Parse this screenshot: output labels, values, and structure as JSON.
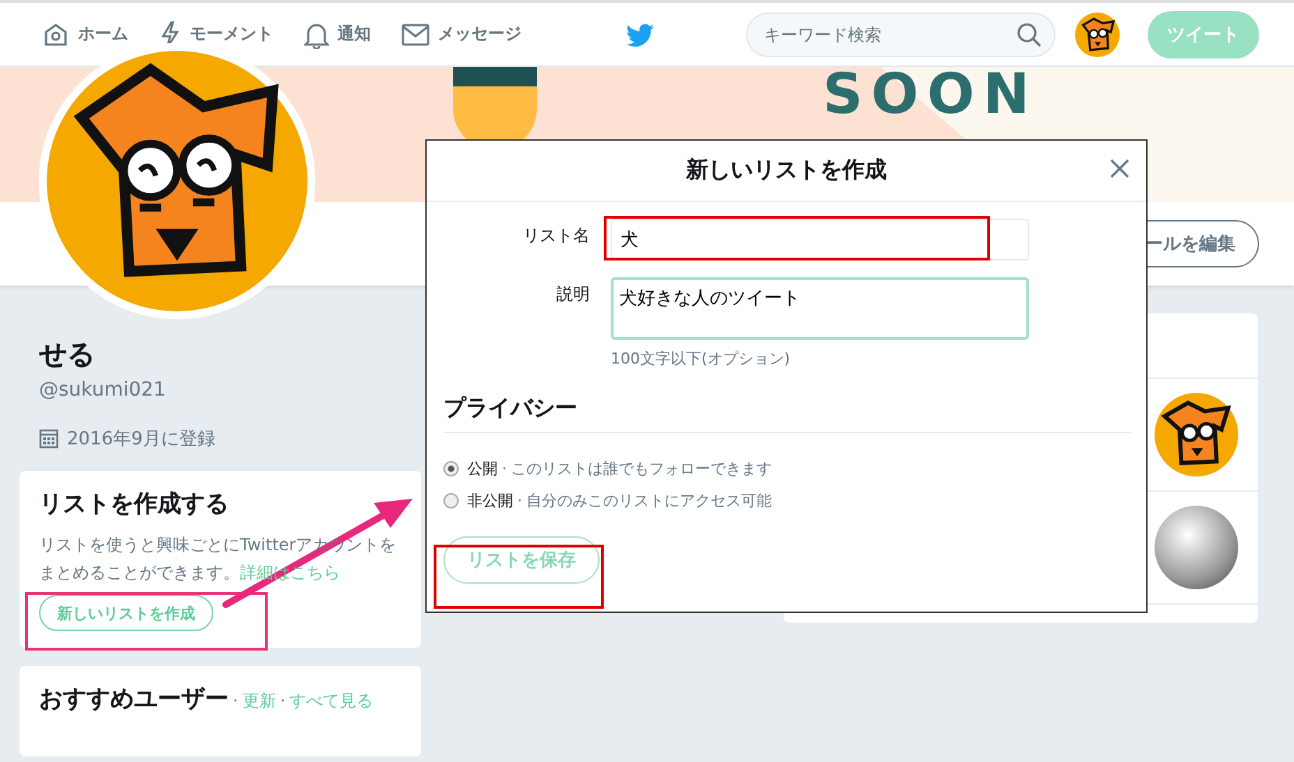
{
  "nav": {
    "items": [
      {
        "label": "ホーム"
      },
      {
        "label": "モーメント"
      },
      {
        "label": "通知"
      },
      {
        "label": "メッセージ"
      }
    ],
    "search": {
      "placeholder": "キーワード検索"
    },
    "tweet_button": "ツイート"
  },
  "banner": {
    "text": "SOON"
  },
  "profile_nav": {
    "edit_button": "ールを編集"
  },
  "profile": {
    "name": "せる",
    "handle": "@sukumi021",
    "joined": "2016年9月に登録"
  },
  "create_list_card": {
    "title": "リストを作成する",
    "text": "リストを使うと興味ごとにTwitterアカウントをまとめることができます。",
    "link": "詳細はこちら",
    "button": "新しいリストを作成"
  },
  "recommended": {
    "title": "おすすめユーザー",
    "separator": "·",
    "links": [
      "更新",
      "すべて見る"
    ]
  },
  "modal": {
    "title": "新しいリストを作成",
    "fields": [
      {
        "kind": "input",
        "label": "リスト名",
        "value": "犬"
      },
      {
        "kind": "textarea",
        "label": "説明",
        "value": "犬好きな人のツイート",
        "hint": "100文字以下(オプション)"
      }
    ],
    "privacy_title": "プライバシー",
    "options": [
      {
        "label": "公開",
        "separator": "·",
        "description": "このリストは誰でもフォローできます",
        "selected": true
      },
      {
        "label": "非公開",
        "separator": "·",
        "description": "自分のみこのリストにアクセス可能",
        "selected": false
      }
    ],
    "save_button": "リストを保存"
  }
}
